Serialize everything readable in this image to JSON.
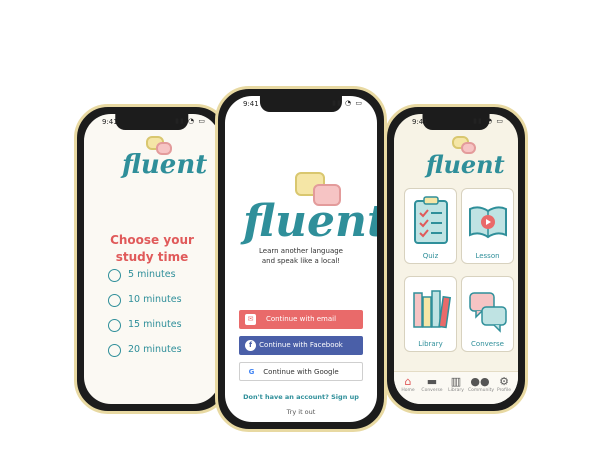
{
  "status": {
    "time": "9:41"
  },
  "brand": {
    "name": "fluent"
  },
  "study_screen": {
    "title_line1": "Choose your",
    "title_line2": "study time",
    "options": [
      "5 minutes",
      "10 minutes",
      "15 minutes",
      "20 minutes"
    ]
  },
  "login_screen": {
    "tagline_line1": "Learn another language",
    "tagline_line2": "and speak like a local!",
    "email_label": "Continue with email",
    "facebook_label": "Continue with Facebook",
    "google_label": "Continue with Google",
    "signup_text": "Don't have an account? Sign up",
    "try_text": "Try it out"
  },
  "home_screen": {
    "tiles": [
      "Quiz",
      "Lesson",
      "Library",
      "Converse"
    ],
    "tabs": [
      "Home",
      "Converse",
      "Library",
      "Community",
      "Profile"
    ]
  },
  "colors": {
    "teal": "#2f8f9a",
    "coral": "#e05a5a",
    "facebook": "#4a5fa8",
    "frame": "#e8d9a2"
  }
}
